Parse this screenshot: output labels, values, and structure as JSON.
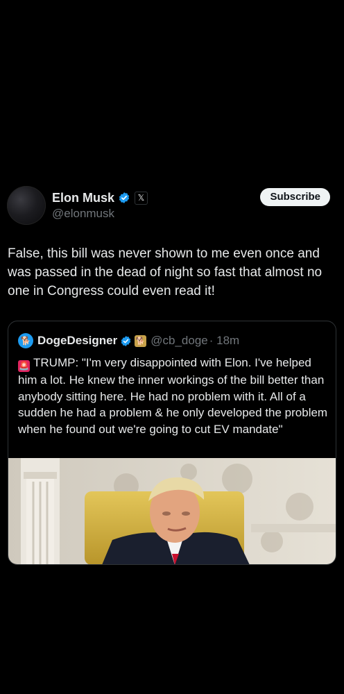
{
  "post": {
    "author": {
      "display_name": "Elon Musk",
      "handle": "@elonmusk"
    },
    "subscribe_label": "Subscribe",
    "text": "False, this bill was never shown to me even once and was passed in the dead of night so fast that almost no one in Congress could even read it!",
    "quote": {
      "author": {
        "display_name": "DogeDesigner",
        "handle": "@cb_doge",
        "time": "· 18m"
      },
      "text": "TRUMP: \"I'm very disappointed with Elon. I've helped him a lot. He knew the inner workings of the bill better than anybody sitting here. He had no problem with it. All of a sudden he had a problem & he only developed the problem when he found out we're going to cut EV mandate\""
    }
  },
  "colors": {
    "background": "#000000",
    "verified": "#1d9bf0",
    "text": "#e7e9ea",
    "muted": "#71767b"
  },
  "icons": {
    "verified": "verified-badge-icon",
    "affiliate": "x-affiliate-icon",
    "siren": "siren-emoji-icon"
  }
}
